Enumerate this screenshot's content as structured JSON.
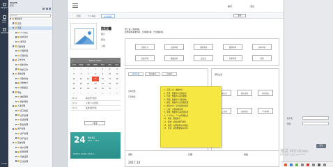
{
  "rail": {
    "items": [
      {
        "label": "PROJECTS"
      },
      {
        "label": "WEB APP"
      },
      {
        "label": "BROWSE"
      }
    ],
    "status": "CLOSE"
  },
  "explorer": {
    "title": "PAGES",
    "subtitle": "首页",
    "search_placeholder": "Search",
    "tree": [
      {
        "label": "通知提示",
        "level": 0,
        "sel": false
      },
      {
        "label": "首页",
        "level": 1,
        "sel": false
      },
      {
        "label": "首页",
        "level": 1,
        "sel": true
      },
      {
        "label": "个人中心",
        "level": 2,
        "sel": false
      },
      {
        "label": "动态消息",
        "level": 2,
        "sel": false
      },
      {
        "label": "通讯录",
        "level": 2,
        "sel": false
      },
      {
        "label": "日程管理",
        "level": 1,
        "sel": false
      },
      {
        "label": "日程安排",
        "level": 2,
        "sel": false
      },
      {
        "label": "日程查看",
        "level": 2,
        "sel": false
      },
      {
        "label": "工作日志",
        "level": 1,
        "sel": false
      },
      {
        "label": "我的日志",
        "level": 2,
        "sel": false
      },
      {
        "label": "我的工作",
        "level": 2,
        "sel": false
      },
      {
        "label": "考勤管理",
        "level": 1,
        "sel": false
      },
      {
        "label": "考勤查询",
        "level": 2,
        "sel": false
      },
      {
        "label": "考勤统计",
        "level": 2,
        "sel": false
      },
      {
        "label": "考勤报表",
        "level": 2,
        "sel": false
      },
      {
        "label": "审批",
        "level": 1,
        "sel": false
      },
      {
        "label": "发起审批",
        "level": 2,
        "sel": false
      },
      {
        "label": "我的审批",
        "level": 2,
        "sel": false
      },
      {
        "label": "人事管理",
        "level": 1,
        "sel": false
      },
      {
        "label": "员工档案",
        "level": 2,
        "sel": false
      },
      {
        "label": "合同管理",
        "level": 2,
        "sel": false
      },
      {
        "label": "薪资管理",
        "level": 2,
        "sel": false
      },
      {
        "label": "职位管理",
        "level": 2,
        "sel": false
      },
      {
        "label": "资产管理",
        "level": 1,
        "sel": false
      },
      {
        "label": "资产管理",
        "level": 2,
        "sel": false
      },
      {
        "label": "资产盘点",
        "level": 2,
        "sel": false
      },
      {
        "label": "系统管理",
        "level": 1,
        "sel": false
      },
      {
        "label": "用户管理",
        "level": 2,
        "sel": false
      },
      {
        "label": "权限管理",
        "level": 2,
        "sel": false
      },
      {
        "label": "系统设置",
        "level": 2,
        "sel": false
      },
      {
        "label": "日志管理",
        "level": 2,
        "sel": false
      }
    ]
  },
  "topbar": {
    "user": "曲问",
    "logout": "退出"
  },
  "tabs": [
    {
      "label": "首页",
      "active": false
    },
    {
      "label": "个人中心",
      "active": false
    },
    {
      "label": "主动消息",
      "active": true
    }
  ],
  "tab_more": "更多",
  "profile": {
    "name": "陈晓曦",
    "dept": "部门",
    "role": "职位",
    "status": "上级"
  },
  "calendar": {
    "month": "March 2017",
    "prev": "‹",
    "next": "›",
    "weekdays": [
      "SUN",
      "MON",
      "TUE",
      "WED",
      "THU",
      "FRI",
      "SAT"
    ],
    "days": [
      {
        "d": "26",
        "m": true
      },
      {
        "d": "27",
        "m": true
      },
      {
        "d": "28",
        "m": true
      },
      {
        "d": "1",
        "m": false
      },
      {
        "d": "2",
        "m": false
      },
      {
        "d": "3",
        "m": false
      },
      {
        "d": "4",
        "m": false
      },
      {
        "d": "5",
        "m": false
      },
      {
        "d": "6",
        "m": false
      },
      {
        "d": "7",
        "m": false
      },
      {
        "d": "8",
        "m": false
      },
      {
        "d": "9",
        "m": false
      },
      {
        "d": "10",
        "m": false
      },
      {
        "d": "11",
        "m": false
      },
      {
        "d": "12",
        "m": false
      },
      {
        "d": "13",
        "m": false
      },
      {
        "d": "14",
        "m": false
      },
      {
        "d": "15",
        "m": false,
        "t": true
      },
      {
        "d": "16",
        "m": false
      },
      {
        "d": "17",
        "m": false
      },
      {
        "d": "18",
        "m": false
      },
      {
        "d": "19",
        "m": false
      },
      {
        "d": "20",
        "m": false
      },
      {
        "d": "21",
        "m": false
      },
      {
        "d": "22",
        "m": false
      },
      {
        "d": "23",
        "m": false
      },
      {
        "d": "24",
        "m": false
      },
      {
        "d": "25",
        "m": false
      },
      {
        "d": "26",
        "m": false
      },
      {
        "d": "27",
        "m": false
      },
      {
        "d": "28",
        "m": false
      },
      {
        "d": "29",
        "m": false
      },
      {
        "d": "30",
        "m": false
      },
      {
        "d": "31",
        "m": false
      },
      {
        "d": "1",
        "m": true
      },
      {
        "d": "2",
        "m": true
      },
      {
        "d": "3",
        "m": true
      },
      {
        "d": "4",
        "m": true
      },
      {
        "d": "5",
        "m": true
      },
      {
        "d": "6",
        "m": true
      },
      {
        "d": "7",
        "m": true
      },
      {
        "d": "8",
        "m": true
      }
    ],
    "events": [
      {
        "k": "09:00",
        "v": "事业部门会议"
      },
      {
        "k": "14:00",
        "v": "人资门人员研究"
      },
      {
        "k": "16:00",
        "v": "发布项目考核"
      }
    ],
    "more": "+更多"
  },
  "weather": {
    "temp": "24",
    "desc1": "晴转多云",
    "desc2": "24℃ ~ 31℃",
    "city": "Weather Update: Partly C..."
  },
  "notice": {
    "line1": "早上好，陈晓曦！",
    "line2": "您的待办审批5项，已审批0项，已处理0项。"
  },
  "quick": [
    "考勤打卡",
    "出差申请",
    "请假申请",
    "报销申请",
    "用车申请",
    "加班申请",
    "物品领用",
    "会议室",
    "印章申请",
    "其他"
  ],
  "panel_left": {
    "tabs": [
      "我的审批",
      "我的发起",
      "已处理"
    ],
    "label1": "待审批数：",
    "label2": "已审数量："
  },
  "panel_right": {
    "title": "通知公告",
    "buttons": [
      "通知公告",
      "制度流程",
      "新闻动态",
      "员工风采",
      "规章制度",
      "学习园地"
    ]
  },
  "sticky": [
    "1、首页入口：数据中心",
    "2、登录：数据中心页面信息",
    "3、待办：数据中心的审批数",
    "4、考勤：数据中心考勤状态",
    "5、报表：数据中心各类报表数",
    "6、通知公告：显示最新的消息",
    "7、日程：日程提醒功能",
    "8、审批：数据中心审批流程单",
    "9、个人中心：个人的基础信息",
    "10、系统：数据统计",
    "11、最新：系统功能已更新",
    "12、说明：左侧菜单可以收缩",
    "13、注意：系统数据保存时间"
  ],
  "bottom": {
    "h1": "通知",
    "h2": "日期",
    "h3": "类型",
    "date": "2017.10"
  },
  "login": {
    "f1": "账户名：",
    "f2": "密码："
  },
  "login_btn": "登录",
  "watermark": {
    "line1": "激活 Windows",
    "line2": "转到\"设置\"以激活 Windows。"
  },
  "colors": {
    "accent": "#2b7fc7",
    "today": "#e8503a",
    "sticky": "#f7e743",
    "weather": "#2b8e89"
  }
}
